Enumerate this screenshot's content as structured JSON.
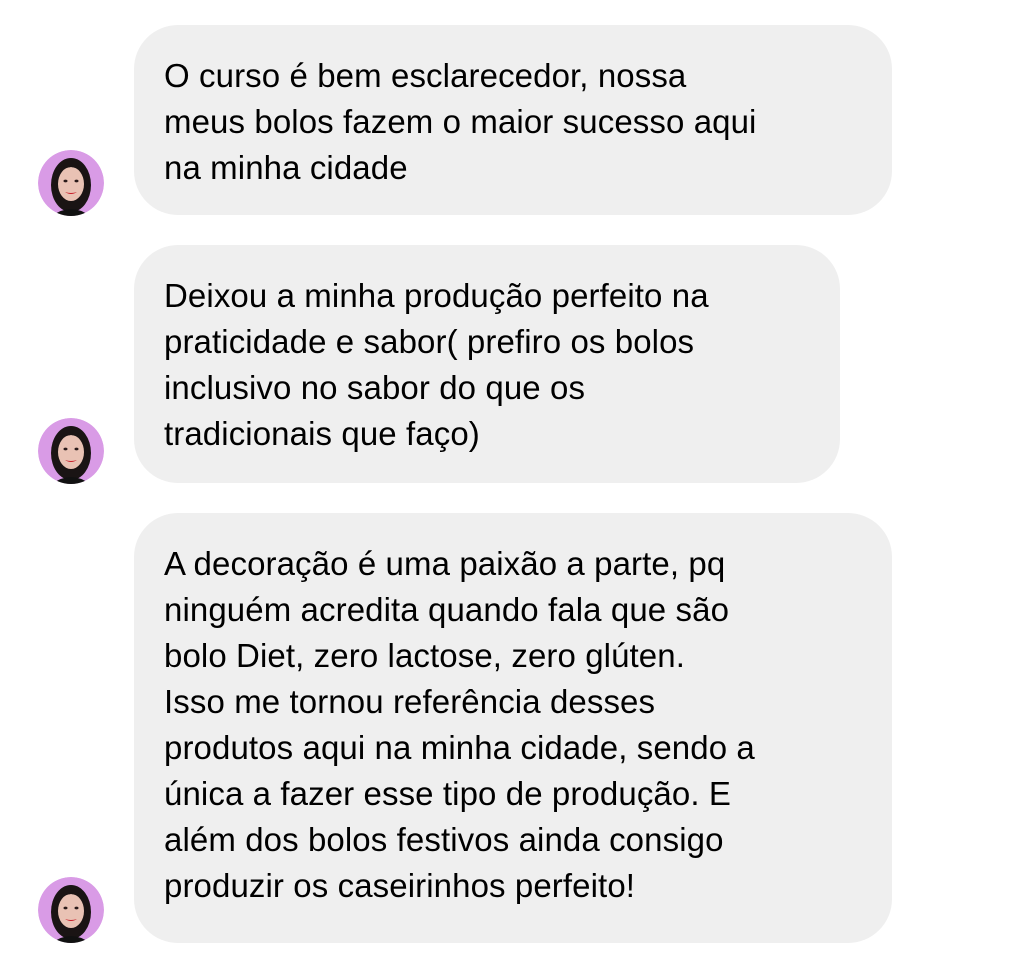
{
  "thread": {
    "messages": [
      {
        "text": "O curso é bem esclarecedor, nossa\nmeus bolos fazem o maior sucesso aqui\nna minha cidade",
        "avatar_icon": "profile-avatar"
      },
      {
        "text": "Deixou a minha produção perfeito na\npraticidade e sabor( prefiro os bolos\ninclusivo no sabor do que os\ntradicionais que faço)",
        "avatar_icon": "profile-avatar"
      },
      {
        "text": "A decoração é uma paixão a parte, pq\nninguém acredita quando fala que são\nbolo Diet, zero lactose, zero glúten.\nIsso me tornou referência desses\nprodutos aqui na minha cidade, sendo a\núnica a fazer esse tipo de produção. E\nalém dos bolos festivos ainda consigo\nproduzir os caseirinhos perfeito!",
        "avatar_icon": "profile-avatar"
      }
    ]
  },
  "colors": {
    "bubble_background": "#efefef",
    "text": "#000000",
    "avatar_ring": "#d99be6",
    "avatar_hair": "#1a1414",
    "avatar_skin": "#e9c2b4",
    "avatar_lips": "#c81e2a"
  }
}
